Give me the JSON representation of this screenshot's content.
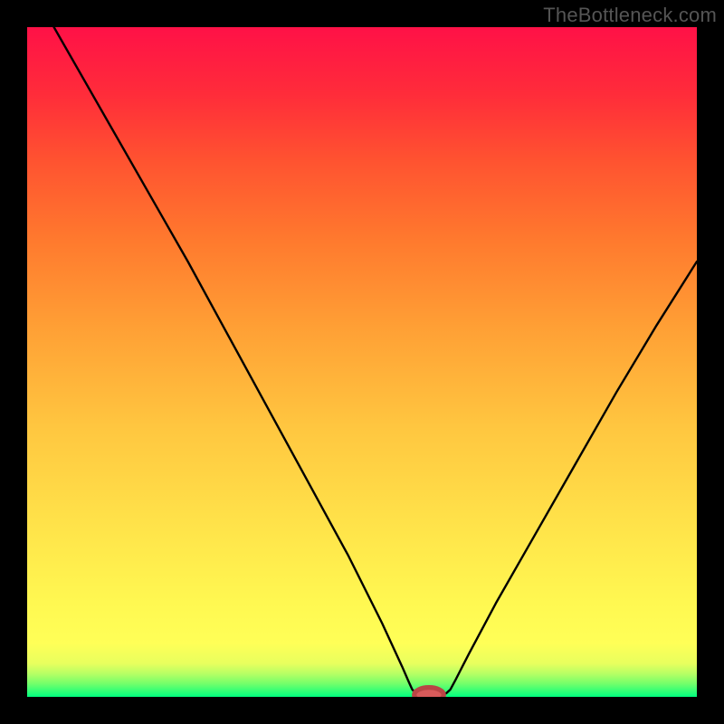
{
  "attribution": "TheBottleneck.com",
  "colors": {
    "black": "#000000",
    "marker": "#d85a5a",
    "marker_stroke": "#b94545"
  },
  "chart_data": {
    "type": "line",
    "title": "",
    "xlabel": "",
    "ylabel": "",
    "xlim": [
      0,
      100
    ],
    "ylim": [
      0,
      100
    ],
    "curve_xy": [
      [
        4,
        100
      ],
      [
        12,
        86
      ],
      [
        20,
        72
      ],
      [
        24,
        65
      ],
      [
        30,
        54
      ],
      [
        36,
        43
      ],
      [
        42,
        32
      ],
      [
        48,
        21
      ],
      [
        53,
        11
      ],
      [
        56,
        4.5
      ],
      [
        57,
        2.2
      ],
      [
        57.5,
        1.1
      ],
      [
        58,
        0.55
      ],
      [
        58.8,
        0.35
      ],
      [
        60,
        0.35
      ],
      [
        61.2,
        0.35
      ],
      [
        62,
        0.35
      ],
      [
        62.6,
        0.55
      ],
      [
        63.2,
        1.1
      ],
      [
        64,
        2.6
      ],
      [
        66,
        6.5
      ],
      [
        70,
        14
      ],
      [
        76,
        24.5
      ],
      [
        82,
        35
      ],
      [
        88,
        45.5
      ],
      [
        94,
        55.5
      ],
      [
        100,
        65
      ]
    ],
    "marker": {
      "x": 60,
      "y": 0.3,
      "rx": 2.2,
      "ry": 1.1
    }
  }
}
